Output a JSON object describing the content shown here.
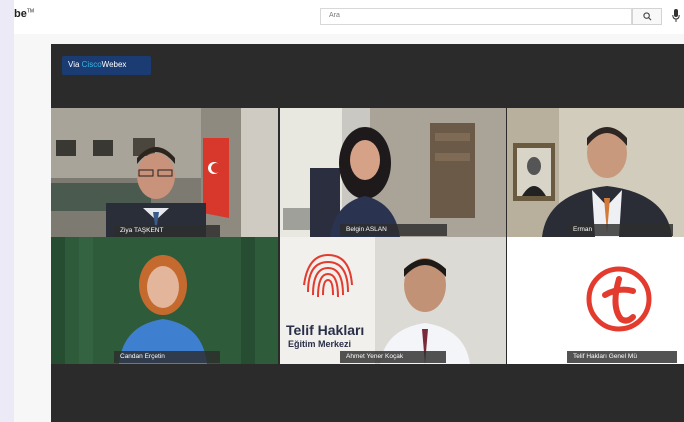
{
  "youtube": {
    "logo": "be",
    "logo_tm": "TM"
  },
  "search": {
    "placeholder": "Ara"
  },
  "webex": {
    "prefix": "Via ",
    "cisco": "Cisco",
    "webex": "Webex"
  },
  "participants": [
    {
      "name": "Ziya TAŞKENT"
    },
    {
      "name": "Belgin ASLAN"
    },
    {
      "name": "Erman"
    },
    {
      "name": "Candan Erçetin"
    },
    {
      "name": "Ahmet Yener Koçak"
    },
    {
      "name": "Telif Hakları Genel Mü"
    }
  ],
  "tile_logo": {
    "line1": "Telif Hakları",
    "line2": "Eğitim Merkezi"
  },
  "colors": {
    "accent_red": "#e33b2e",
    "webex_blue": "#1b3b73",
    "cisco_blue": "#33b8e8"
  }
}
